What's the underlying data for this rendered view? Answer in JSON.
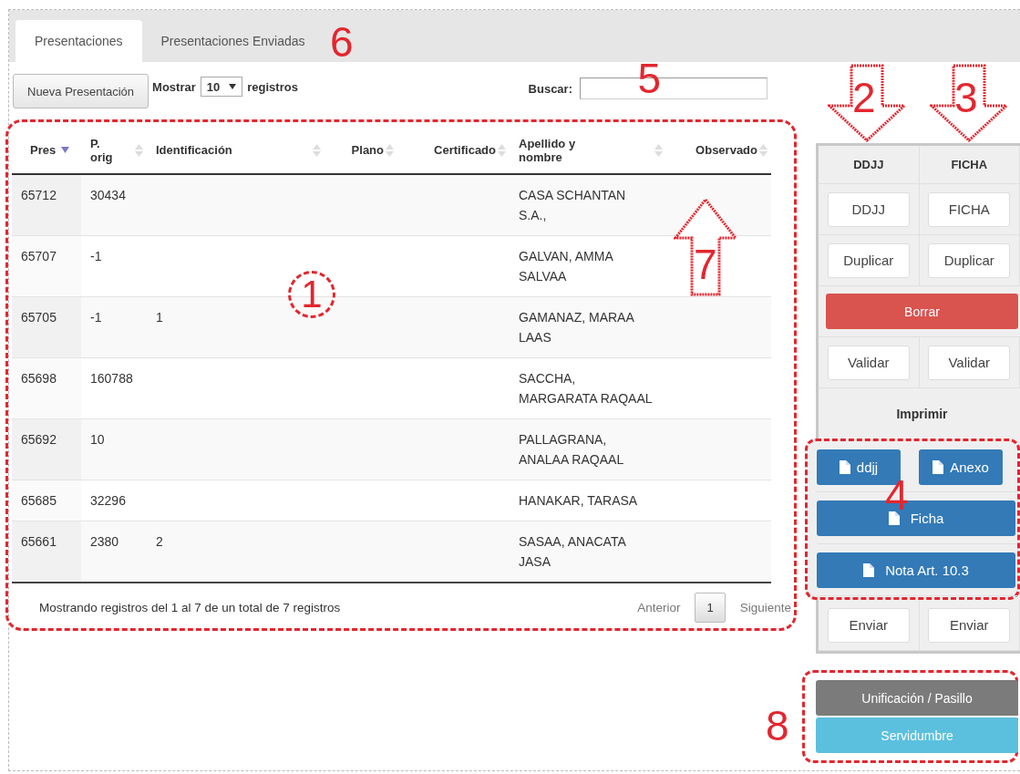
{
  "tabs": [
    {
      "label": "Presentaciones",
      "selected": true
    },
    {
      "label": "Presentaciones Enviadas",
      "selected": false
    }
  ],
  "tabs_callout": "6",
  "toolbar": {
    "new_button": "Nueva Presentación",
    "length": {
      "label_before": "Mostrar",
      "value": "10",
      "label_after": "registros"
    },
    "search": {
      "label": "Buscar:",
      "callout": "5"
    }
  },
  "table": {
    "outlined": true,
    "callout": "1",
    "arrow_callout": "7",
    "columns": [
      {
        "label": "Pres",
        "sorted": true
      },
      {
        "label": "P. orig",
        "sorted": false
      },
      {
        "label": "Identificación",
        "sorted": false
      },
      {
        "label": "Plano",
        "sorted": false
      },
      {
        "label": "Certificado",
        "sorted": false
      },
      {
        "label": "Apellido y nombre",
        "sorted": false
      },
      {
        "label": "Observado",
        "sorted": false
      }
    ],
    "rows": [
      {
        "pres": "65712",
        "p_orig": "30434",
        "apellido_y_nombre": "CASA SCHANTAN S.A.,"
      },
      {
        "pres": "65707",
        "p_orig": "-1",
        "apellido_y_nombre": "GALVAN, AMMA SALVAA"
      },
      {
        "pres": "65705",
        "p_orig": "-1",
        "identificacion": "1",
        "apellido_y_nombre": "GAMANAZ, MARAA LAAS"
      },
      {
        "pres": "65698",
        "p_orig": "160788",
        "apellido_y_nombre": "SACCHA, MARGARATA RAQAAL"
      },
      {
        "pres": "65692",
        "p_orig": "10",
        "apellido_y_nombre": "PALLAGRANA, ANALAA RAQAAL"
      },
      {
        "pres": "65685",
        "p_orig": "32296",
        "apellido_y_nombre": "HANAKAR, TARASA"
      },
      {
        "pres": "65661",
        "p_orig": "2380",
        "identificacion": "2",
        "apellido_y_nombre": "SASAA, ANACATA JASA"
      }
    ],
    "info": "Mostrando registros del 1 al 7 de un total de 7 registros",
    "pagination": {
      "previous": "Anterior",
      "pages": [
        {
          "label": "1",
          "selected": true
        }
      ],
      "next": "Siguiente"
    }
  },
  "actions_panel": {
    "headers": [
      {
        "label": "DDJJ",
        "callout": "2"
      },
      {
        "label": "FICHA",
        "callout": "3"
      }
    ],
    "rows": [
      {
        "kind": "pair",
        "buttons": [
          "DDJJ",
          "FICHA"
        ]
      },
      {
        "kind": "pair",
        "buttons": [
          "Duplicar",
          "Duplicar"
        ]
      },
      {
        "kind": "delete",
        "label": "Borrar"
      },
      {
        "kind": "pair",
        "buttons": [
          "Validar",
          "Validar"
        ]
      },
      {
        "kind": "heading",
        "label": "Imprimir"
      },
      {
        "kind": "print_group",
        "callout": "4",
        "rows": [
          [
            "ddjj",
            "Anexo"
          ],
          [
            "Ficha"
          ],
          [
            "Nota Art. 10.3"
          ]
        ]
      },
      {
        "kind": "pair",
        "buttons": [
          "Enviar",
          "Enviar"
        ]
      }
    ]
  },
  "extra_actions": {
    "callout": "8",
    "buttons": [
      "Unificación / Pasillo",
      "Servidumbre"
    ]
  }
}
